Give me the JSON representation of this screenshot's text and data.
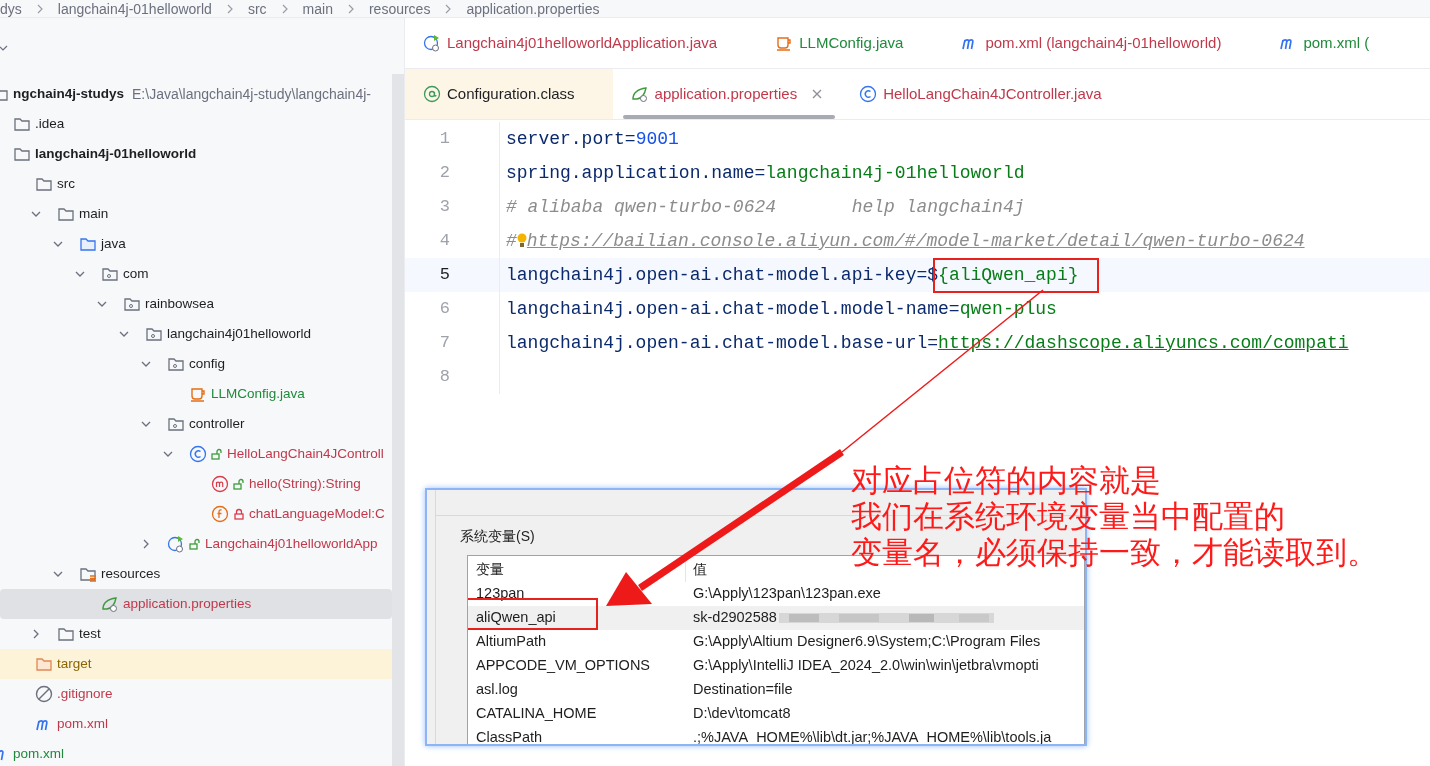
{
  "breadcrumb": [
    "dys",
    "langchain4j-01helloworld",
    "src",
    "main",
    "resources",
    "application.properties"
  ],
  "project_tree": [
    {
      "label": "ngchain4j-studys",
      "path": "E:\\Java\\langchain4j-study\\langchain4j-",
      "kind": "module",
      "color": "#1e1f22",
      "selected": false,
      "children": [
        {
          "label": ".idea",
          "kind": "folder",
          "color": "#1e1f22",
          "selected": false
        },
        {
          "label": "langchain4j-01helloworld",
          "kind": "module",
          "color": "#1e1f22",
          "selected": false,
          "children": [
            {
              "label": "src",
              "kind": "folder",
              "color": "#1e1f22",
              "selected": false,
              "children": [
                {
                  "label": "main",
                  "kind": "folder",
                  "color": "#1e1f22",
                  "selected": false,
                  "expanded": true,
                  "children": [
                    {
                      "label": "java",
                      "kind": "source-folder",
                      "color": "#1e1f22",
                      "selected": false,
                      "expanded": true,
                      "children": [
                        {
                          "label": "com",
                          "kind": "package",
                          "color": "#1e1f22",
                          "selected": false,
                          "expanded": true,
                          "children": [
                            {
                              "label": "rainbowsea",
                              "kind": "package",
                              "color": "#1e1f22",
                              "selected": false,
                              "expanded": true,
                              "children": [
                                {
                                  "label": "langchain4j01helloworld",
                                  "kind": "package",
                                  "color": "#1e1f22",
                                  "selected": false,
                                  "expanded": true,
                                  "children": [
                                    {
                                      "label": "config",
                                      "kind": "package",
                                      "color": "#1e1f22",
                                      "selected": false,
                                      "expanded": true,
                                      "children": [
                                        {
                                          "label": "LLMConfig.java",
                                          "kind": "java-config",
                                          "color": "#1f8a3a",
                                          "selected": false
                                        }
                                      ]
                                    },
                                    {
                                      "label": "controller",
                                      "kind": "package",
                                      "color": "#1e1f22",
                                      "selected": false,
                                      "expanded": true,
                                      "children": [
                                        {
                                          "label": "HelloLangChain4JControll",
                                          "kind": "class",
                                          "locked": false,
                                          "color": "#c0394b",
                                          "selected": false,
                                          "expanded": true,
                                          "children": [
                                            {
                                              "label": "hello(String):String",
                                              "kind": "method",
                                              "locked": false,
                                              "color": "#c0394b",
                                              "selected": false
                                            },
                                            {
                                              "label": "chatLanguageModel:C",
                                              "kind": "field",
                                              "locked": true,
                                              "color": "#c0394b",
                                              "selected": false
                                            }
                                          ]
                                        }
                                      ]
                                    },
                                    {
                                      "label": "Langchain4j01helloworldApp",
                                      "kind": "spring-app",
                                      "locked": false,
                                      "color": "#c0394b",
                                      "selected": false,
                                      "expanded": false
                                    }
                                  ]
                                }
                              ]
                            }
                          ]
                        }
                      ]
                    },
                    {
                      "label": "resources",
                      "kind": "resources",
                      "color": "#1e1f22",
                      "selected": false,
                      "expanded": true,
                      "children": [
                        {
                          "label": "application.properties",
                          "kind": "properties",
                          "color": "#c0394b",
                          "selected": true
                        }
                      ]
                    }
                  ]
                },
                {
                  "label": "test",
                  "kind": "folder",
                  "color": "#1e1f22",
                  "selected": false,
                  "expanded": false
                }
              ]
            },
            {
              "label": "target",
              "kind": "excluded",
              "color": "#8a6500",
              "selected": false
            },
            {
              "label": ".gitignore",
              "kind": "gitignore",
              "color": "#c0394b",
              "selected": false
            },
            {
              "label": "pom.xml",
              "kind": "maven",
              "color": "#c0394b",
              "selected": false
            }
          ]
        }
      ]
    },
    {
      "label": "pom.xml",
      "kind": "maven",
      "color": "#1f8a3a",
      "selected": false
    }
  ],
  "tab_rows": [
    [
      {
        "label": "Langchain4j01helloworldApplication.java",
        "kind": "spring-app",
        "color": "#c0394b",
        "read_only": false,
        "selected": false
      },
      {
        "label": "LLMConfig.java",
        "kind": "java-config",
        "color": "#1f8a3a",
        "read_only": false,
        "selected": false
      },
      {
        "label": "pom.xml (langchain4j-01helloworld)",
        "kind": "maven",
        "color": "#c0394b",
        "read_only": false,
        "selected": false
      },
      {
        "label": "pom.xml (",
        "kind": "maven",
        "color": "#1f8a3a",
        "read_only": false,
        "selected": false
      }
    ],
    [
      {
        "label": "Configuration.class",
        "kind": "annotation",
        "color": "#1e1f22",
        "read_only": true,
        "selected": false
      },
      {
        "label": "application.properties",
        "kind": "properties",
        "color": "#c0394b",
        "read_only": false,
        "selected": true
      },
      {
        "label": "HelloLangChain4JController.java",
        "kind": "class",
        "color": "#c0394b",
        "read_only": false,
        "selected": false
      }
    ]
  ],
  "code_lines": [
    {
      "number": "1",
      "current": false,
      "tokens": [
        {
          "kind": "key",
          "text": "server.port="
        },
        {
          "kind": "number",
          "text": "9001"
        }
      ]
    },
    {
      "number": "2",
      "current": false,
      "tokens": [
        {
          "kind": "key",
          "text": "spring.application.name="
        },
        {
          "kind": "value",
          "text": "langchain4j-01helloworld"
        }
      ]
    },
    {
      "number": "3",
      "current": false,
      "tokens": [
        {
          "kind": "comment",
          "text": "# alibaba qwen-turbo-0624       help langchain4j"
        }
      ]
    },
    {
      "number": "4",
      "current": false,
      "tokens": [
        {
          "kind": "comment",
          "text": "#"
        },
        {
          "kind": "bulb"
        },
        {
          "kind": "comment-link",
          "text": "https://bailian.console.aliyun.com/#/model-market/detail/qwen-turbo-0624"
        }
      ]
    },
    {
      "number": "5",
      "current": true,
      "tokens": [
        {
          "kind": "key",
          "text": "langchain4j.open-ai.chat-model.api-key="
        },
        {
          "kind": "plain",
          "text": "$"
        },
        {
          "kind": "value",
          "text": "{aliQwen_api}",
          "boxed": true
        }
      ]
    },
    {
      "number": "6",
      "current": false,
      "tokens": [
        {
          "kind": "key",
          "text": "langchain4j.open-ai.chat-model.model-name="
        },
        {
          "kind": "value",
          "text": "qwen-plus"
        }
      ]
    },
    {
      "number": "7",
      "current": false,
      "tokens": [
        {
          "kind": "key",
          "text": "langchain4j.open-ai.chat-model.base-url="
        },
        {
          "kind": "value-link",
          "text": "https://dashscope.aliyuncs.com/compati"
        }
      ]
    },
    {
      "number": "8",
      "current": false
    }
  ],
  "env_dialog": {
    "group_label": "系统变量(S)",
    "columns": [
      "变量",
      "值"
    ],
    "rows": [
      {
        "name": "123pan",
        "value": "G:\\Apply\\123pan\\123pan.exe",
        "selected": false,
        "boxed": false,
        "blurred": false
      },
      {
        "name": "aliQwen_api",
        "value": "sk-d2902588",
        "selected": true,
        "boxed": true,
        "blurred": true
      },
      {
        "name": "AltiumPath",
        "value": "G:\\Apply\\Altium Designer6.9\\System;C:\\Program Files",
        "selected": false,
        "boxed": false,
        "blurred": false
      },
      {
        "name": "APPCODE_VM_OPTIONS",
        "value": "G:\\Apply\\IntelliJ IDEA_2024_2.0\\win\\win\\jetbra\\vmopti",
        "selected": false,
        "boxed": false,
        "blurred": false
      },
      {
        "name": "asl.log",
        "value": "Destination=file",
        "selected": false,
        "boxed": false,
        "blurred": false
      },
      {
        "name": "CATALINA_HOME",
        "value": "D:\\dev\\tomcat8",
        "selected": false,
        "boxed": false,
        "blurred": false
      },
      {
        "name": "ClassPath",
        "value": ".;%JAVA_HOME%\\lib\\dt.jar;%JAVA_HOME%\\lib\\tools.ja",
        "selected": false,
        "boxed": false,
        "blurred": false
      }
    ]
  },
  "annotation": [
    "对应占位符的内容就是",
    "我们在系统环境变量当中配置的",
    "变量名，必须保持一致，才能读取到。"
  ]
}
